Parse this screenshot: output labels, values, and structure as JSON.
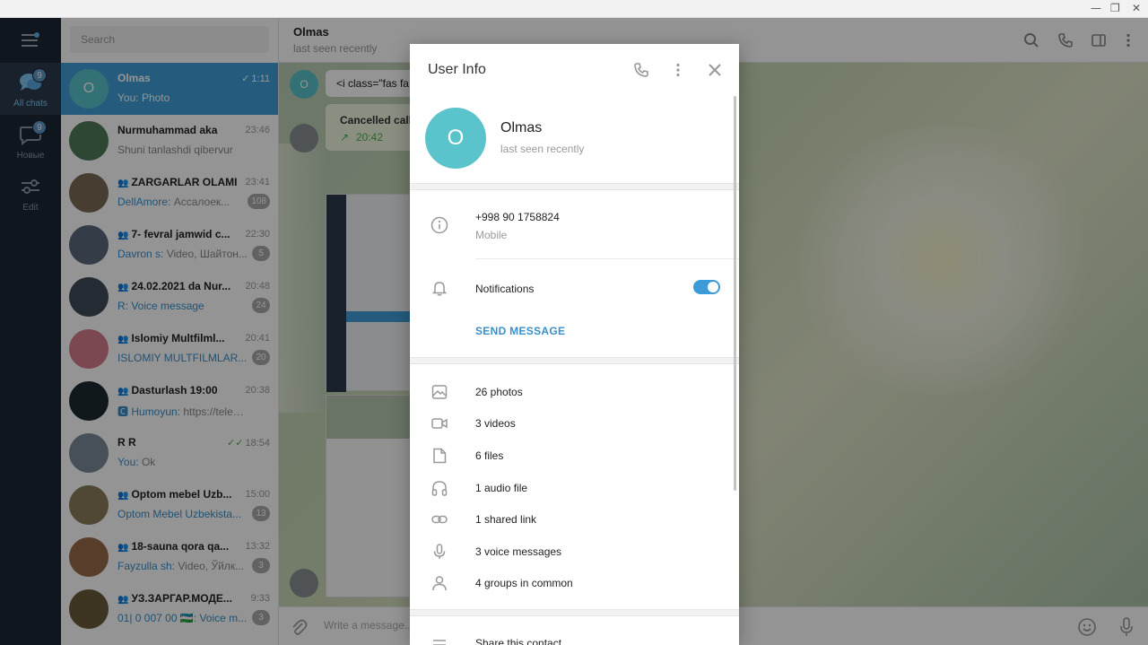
{
  "window": {
    "minimize": "—",
    "restore": "❐",
    "close": "✕"
  },
  "rail": {
    "folders": [
      {
        "label": "All chats",
        "badge": "9"
      },
      {
        "label": "Новые",
        "badge": "9"
      },
      {
        "label": "Edit"
      }
    ]
  },
  "search": {
    "placeholder": "Search"
  },
  "chats": [
    {
      "name": "Olmas",
      "time": "1:11",
      "sender": "You:",
      "preview": "Photo",
      "avatar_letter": "O",
      "avatar_color": "#5bc3cb"
    },
    {
      "name": "Nurmuhammad aka",
      "time": "23:46",
      "preview": "Shuni tanlashdi qibervur",
      "avatar_color": "#4e7a58"
    },
    {
      "name": "ZARGARLAR OLAMI",
      "time": "23:41",
      "sender": "DellAmore:",
      "preview": "Ассалоек...",
      "count": "108",
      "avatar_color": "#7a6a55"
    },
    {
      "name": "7- fevral jamwid c...",
      "time": "22:30",
      "sender": "Davron s:",
      "preview": "Video, Шайтон...",
      "count": "5",
      "avatar_color": "#5a6a7a"
    },
    {
      "name": "24.02.2021 da Nur...",
      "time": "20:48",
      "sender": "R:",
      "preview": "Voice message",
      "count": "24",
      "avatar_color": "#3e4a58"
    },
    {
      "name": "Islomiy Multfilml...",
      "time": "20:41",
      "sender": "ISLOMIY MULTFILMLAR...",
      "preview": "",
      "count": "20",
      "avatar_color": "#d47a8a"
    },
    {
      "name": "Dasturlash 19:00",
      "time": "20:38",
      "sender": "🅲 Humoyun:",
      "preview": "https://telegr...",
      "avatar_color": "#1e2a30"
    },
    {
      "name": "R R",
      "time": "18:54",
      "sender": "You:",
      "preview": "Ok",
      "avatar_color": "#7a8a9a"
    },
    {
      "name": "Optom mebel Uzb...",
      "time": "15:00",
      "sender": "Optom Mebel Uzbekista...",
      "preview": "",
      "count": "13",
      "avatar_color": "#8a7a5a"
    },
    {
      "name": "18-sauna qora qa...",
      "time": "13:32",
      "sender": "Fayzulla sh:",
      "preview": "Video, Ўйлк...",
      "count": "3",
      "avatar_color": "#9a6a4a"
    },
    {
      "name": "УЗ.ЗАРГАР.МОДЕ...",
      "time": "9:33",
      "sender": "01| 0 007 00 🇺🇿:",
      "preview": "Voice m...",
      "count": "3",
      "avatar_color": "#6a5a3a"
    }
  ],
  "chat_header": {
    "title": "Olmas",
    "status": "last seen recently"
  },
  "messages": {
    "code_snippet": "<i class=\"fas fa",
    "call_label": "Cancelled call",
    "call_time": "20:42"
  },
  "composer": {
    "placeholder": "Write a message..."
  },
  "user_info": {
    "title": "User Info",
    "avatar_letter": "O",
    "name": "Olmas",
    "status": "last seen recently",
    "phone": "+998 90 1758824",
    "phone_label": "Mobile",
    "notifications_label": "Notifications",
    "notifications_on": true,
    "send_message": "SEND MESSAGE",
    "media": [
      {
        "icon": "photo-icon",
        "label": "26 photos"
      },
      {
        "icon": "video-icon",
        "label": "3 videos"
      },
      {
        "icon": "file-icon",
        "label": "6 files"
      },
      {
        "icon": "headphones-icon",
        "label": "1 audio file"
      },
      {
        "icon": "link-icon",
        "label": "1 shared link"
      },
      {
        "icon": "microphone-icon",
        "label": "3 voice messages"
      },
      {
        "icon": "user-icon",
        "label": "4 groups in common"
      }
    ],
    "share_contact": "Share this contact"
  }
}
